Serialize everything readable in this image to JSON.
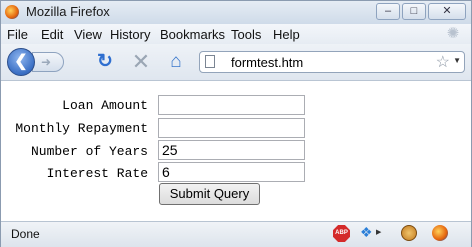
{
  "window": {
    "title": "Mozilla Firefox",
    "minimize_icon": "minimize-icon",
    "maximize_icon": "maximize-icon",
    "close_icon": "close-icon"
  },
  "menu": {
    "file": "File",
    "edit": "Edit",
    "view": "View",
    "history": "History",
    "bookmarks": "Bookmarks",
    "tools": "Tools",
    "help": "Help"
  },
  "nav": {
    "url": "formtest.htm"
  },
  "form": {
    "fields": [
      {
        "label": "Loan Amount",
        "value": ""
      },
      {
        "label": "Monthly Repayment",
        "value": ""
      },
      {
        "label": "Number of Years",
        "value": "25"
      },
      {
        "label": "Interest Rate",
        "value": "6"
      }
    ],
    "submit_label": "Submit Query"
  },
  "status": {
    "text": "Done",
    "abp_label": "ABP"
  }
}
